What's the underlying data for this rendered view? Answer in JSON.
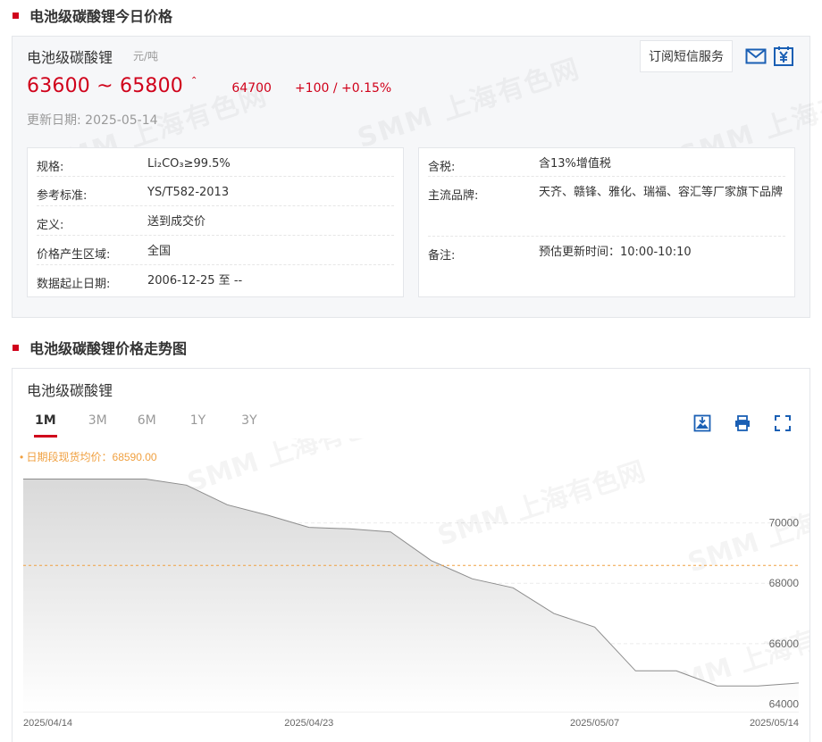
{
  "today": {
    "section_title": "电池级碳酸锂今日价格",
    "product_name": "电池级碳酸锂",
    "unit": "元/吨",
    "price_range": "63600 ~ 65800",
    "trend_glyph": "⌃",
    "average": "64700",
    "change": "+100 / +0.15%",
    "updated": "更新日期:  2025-05-14",
    "subscribe_label": "订阅短信服务",
    "specs_left": [
      {
        "k": "规格:",
        "v": "Li₂CO₃≥99.5%"
      },
      {
        "k": "参考标准:",
        "v": "YS/T582-2013"
      },
      {
        "k": "定义:",
        "v": "送到成交价"
      },
      {
        "k": "价格产生区域:",
        "v": "全国"
      },
      {
        "k": "数据起止日期:",
        "v": "2006-12-25 至 --"
      }
    ],
    "specs_right": [
      {
        "k": "含税:",
        "v": "含13%增值税"
      },
      {
        "k": "主流品牌:",
        "v": "天齐、赣锋、雅化、瑞福、容汇等厂家旗下品牌"
      },
      {
        "k": "备注:",
        "v": "预估更新时间：10:00-10:10"
      }
    ]
  },
  "trend": {
    "section_title": "电池级碳酸锂价格走势图",
    "chart_name": "电池级碳酸锂",
    "tabs": [
      "1M",
      "3M",
      "6M",
      "1Y",
      "3Y"
    ],
    "active_tab": "1M",
    "avg_label": "日期段现货均价：68590.00"
  },
  "watermark_text": "SMM 上海有色网",
  "colors": {
    "accent": "#d0021b",
    "avg_line": "#f0a040",
    "icon": "#1a5fb4"
  },
  "icons": [
    "mail-icon",
    "yuan-icon",
    "image-download-icon",
    "print-icon",
    "fullscreen-icon"
  ],
  "chart_data": {
    "type": "area",
    "title": "",
    "x": [
      "2025/04/14",
      "2025/04/15",
      "2025/04/16",
      "2025/04/17",
      "2025/04/18",
      "2025/04/21",
      "2025/04/22",
      "2025/04/23",
      "2025/04/24",
      "2025/04/25",
      "2025/04/28",
      "2025/04/29",
      "2025/04/30",
      "2025/05/06",
      "2025/05/07",
      "2025/05/08",
      "2025/05/09",
      "2025/05/12",
      "2025/05/13",
      "2025/05/14"
    ],
    "values": [
      71450,
      71450,
      71450,
      71450,
      71250,
      70600,
      70250,
      69850,
      69800,
      69700,
      68750,
      68150,
      67850,
      67000,
      66550,
      65100,
      65100,
      64600,
      64600,
      64700
    ],
    "xtick_labels": [
      "2025/04/14",
      "2025/04/23",
      "2025/05/07",
      "2025/05/14"
    ],
    "yticks": [
      64000,
      66000,
      68000,
      70000
    ],
    "ylim": [
      63750,
      72500
    ],
    "average": 68590.0,
    "grid": true,
    "xlabel": "",
    "ylabel": ""
  }
}
